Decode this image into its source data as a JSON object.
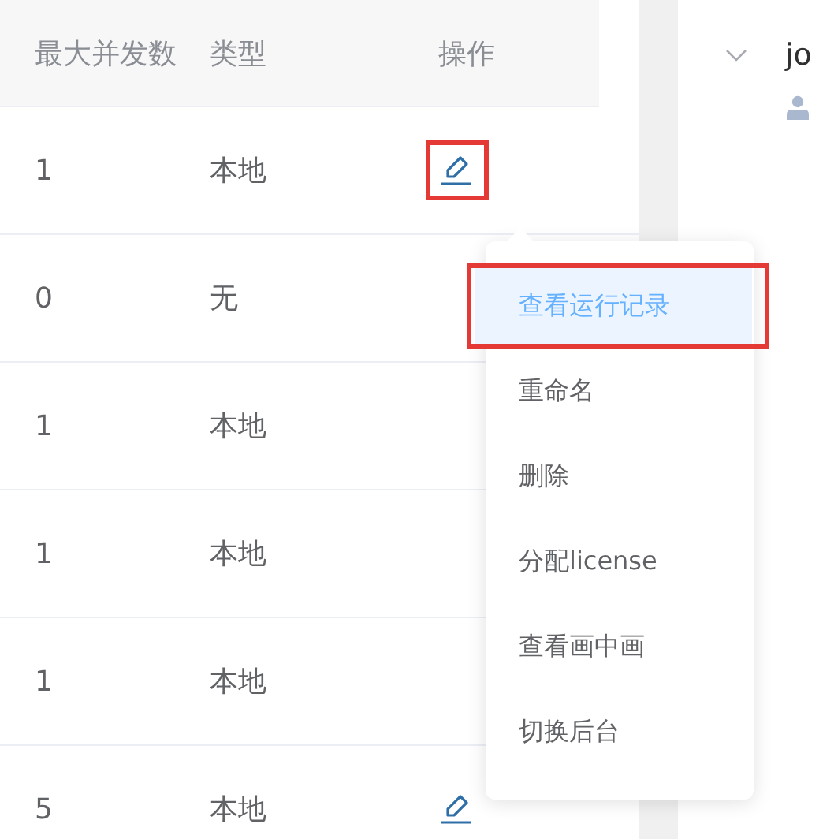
{
  "table": {
    "columns": [
      "最大并发数",
      "类型",
      "操作"
    ],
    "rows": [
      {
        "concurrency": "1",
        "type": "本地",
        "action_highlighted": true
      },
      {
        "concurrency": "0",
        "type": "无"
      },
      {
        "concurrency": "1",
        "type": "本地"
      },
      {
        "concurrency": "1",
        "type": "本地"
      },
      {
        "concurrency": "1",
        "type": "本地"
      },
      {
        "concurrency": "5",
        "type": "本地",
        "action_highlighted": false
      }
    ]
  },
  "menu": {
    "items": [
      {
        "label": "查看运行记录",
        "selected": true,
        "highlighted": true
      },
      {
        "label": "重命名",
        "selected": false,
        "highlighted": false
      },
      {
        "label": "删除",
        "selected": false,
        "highlighted": false
      },
      {
        "label": "分配license",
        "selected": false,
        "highlighted": false
      },
      {
        "label": "查看画中画",
        "selected": false,
        "highlighted": false
      },
      {
        "label": "切换后台",
        "selected": false,
        "highlighted": false
      }
    ]
  },
  "side_panel": {
    "title": "jo"
  }
}
